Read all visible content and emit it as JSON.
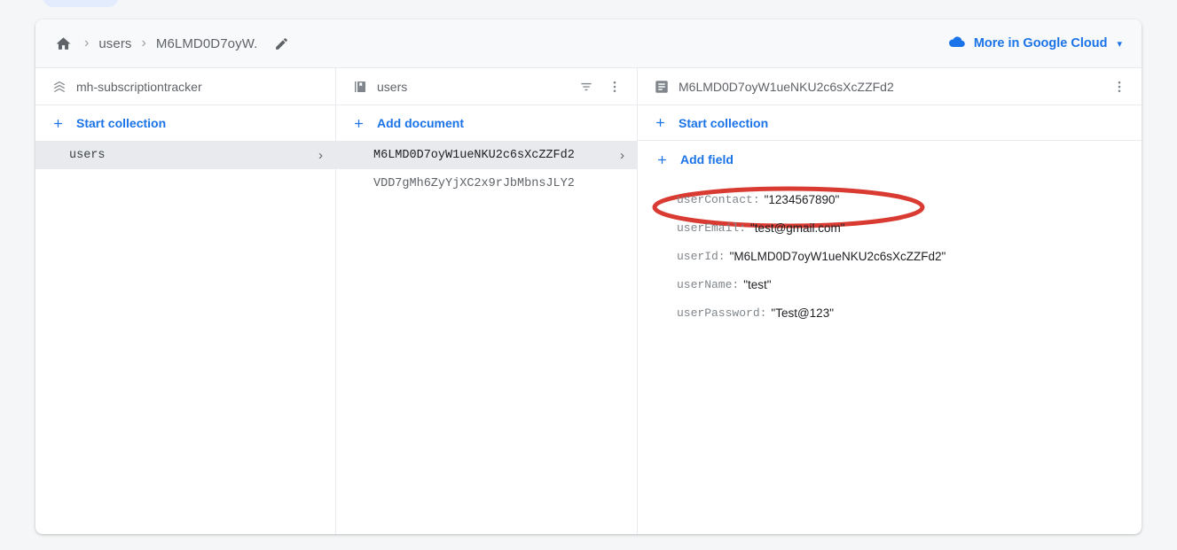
{
  "breadcrumb": {
    "home_icon": "home-icon",
    "separator": "›",
    "items": [
      "users",
      "M6LMD0D7oyW."
    ],
    "edit_icon": "pencil-icon"
  },
  "header": {
    "cloud_link_label": "More in Google Cloud",
    "cloud_icon": "cloud-icon",
    "caret": "▾",
    "link_color": "#1a73e8"
  },
  "panels": {
    "database": {
      "icon": "firestore-database-icon",
      "title": "mh-subscriptiontracker",
      "start_collection_label": "Start collection",
      "collections": [
        {
          "name": "users",
          "selected": true,
          "chevron": "›"
        }
      ]
    },
    "collection": {
      "icon": "collection-icon",
      "title": "users",
      "filter_icon": "filter-icon",
      "menu_icon": "more-vert-icon",
      "add_document_label": "Add document",
      "documents": [
        {
          "id": "M6LMD0D7oyW1ueNKU2c6sXcZZFd2",
          "selected": true,
          "chevron": "›"
        },
        {
          "id": "VDD7gMh6ZyYjXC2x9rJbMbnsJLY2",
          "selected": false,
          "chevron": ""
        }
      ]
    },
    "document": {
      "icon": "document-icon",
      "title": "M6LMD0D7oyW1ueNKU2c6sXcZZFd2",
      "menu_icon": "more-vert-icon",
      "start_collection_label": "Start collection",
      "add_field_label": "Add field",
      "fields": [
        {
          "key": "userContact:",
          "value": "\"1234567890\""
        },
        {
          "key": "userEmail:",
          "value": "\"test@gmail.com\""
        },
        {
          "key": "userId:",
          "value": "\"M6LMD0D7oyW1ueNKU2c6sXcZZFd2\""
        },
        {
          "key": "userName:",
          "value": "\"test\""
        },
        {
          "key": "userPassword:",
          "value": "\"Test@123\""
        }
      ]
    }
  },
  "annotation": {
    "shape": "ellipse",
    "color": "#d93b32",
    "target": "M6LMD0D7oyW1ueNKU2c6sXcZZFd2"
  }
}
